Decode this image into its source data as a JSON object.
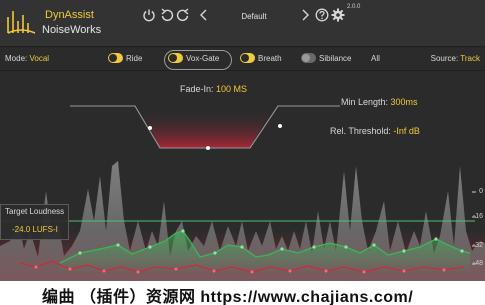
{
  "header": {
    "brand_top": "DynAssist",
    "brand_bottom": "NoiseWorks",
    "preset": "Default",
    "version": "2.0.0",
    "icons": [
      "power-icon",
      "undo-icon",
      "redo-icon",
      "prev-preset-icon",
      "next-preset-icon",
      "help-icon",
      "gear-icon"
    ]
  },
  "modebar": {
    "mode_prefix": "Mode: ",
    "mode_value": "Vocal",
    "tabs": [
      {
        "label": "Ride",
        "on": true
      },
      {
        "label": "Vox-Gate",
        "on": true,
        "selected": true
      },
      {
        "label": "Breath",
        "on": true
      },
      {
        "label": "Sibilance",
        "on": false
      }
    ],
    "all_label": "All",
    "source_prefix": "Source: ",
    "source_value": "Track"
  },
  "gate": {
    "fade_prefix": "Fade-In: ",
    "fade_value": "100 MS",
    "minlen_prefix": "Min Length: ",
    "minlen_value": "300ms",
    "thresh_prefix": "Rel. Threshold: ",
    "thresh_value": "-Inf dB"
  },
  "loudness": {
    "title": "Target Loudness",
    "value": "-24.0 LUFS-I"
  },
  "scale": {
    "ticks": [
      "0",
      "-16",
      "-32",
      "-48"
    ]
  },
  "colors": {
    "accent": "#f0c93d",
    "gate_red": "#d2263a",
    "target_line": "#4fbf78",
    "ride_green": "#3fb35a"
  },
  "watermark": "编曲 （插件）资源网   https://www.chajians.com/"
}
